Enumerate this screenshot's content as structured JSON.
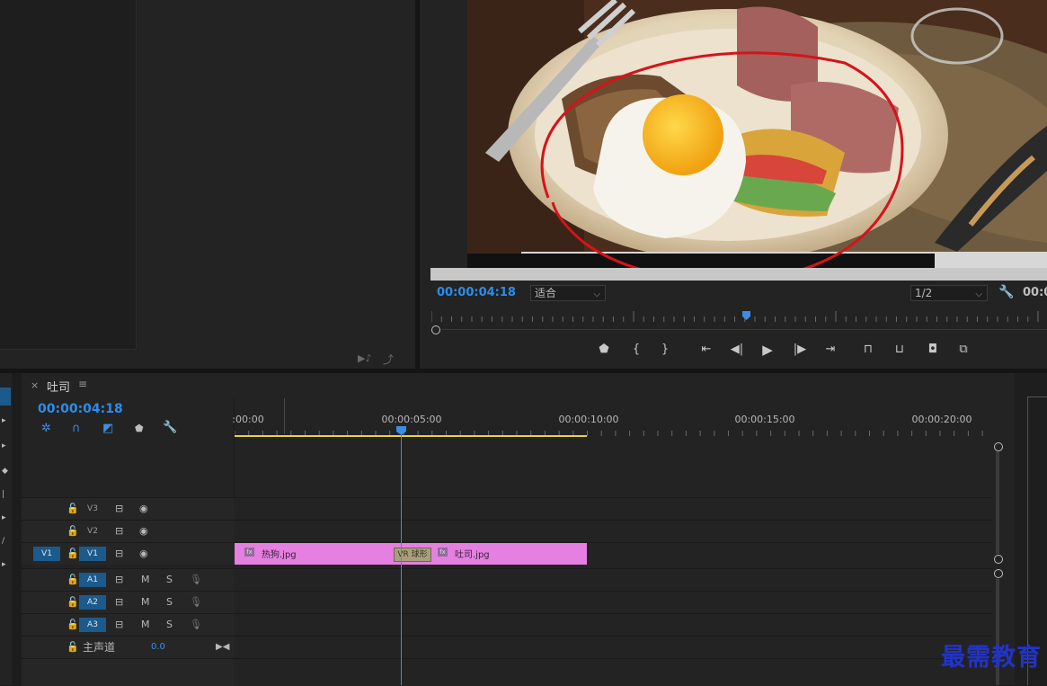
{
  "program_monitor": {
    "timecode": "00:00:04:18",
    "zoom_select": "适合",
    "resolution_select": "1/2",
    "timecode_right": "00:0"
  },
  "timeline": {
    "close": "×",
    "sequence_name": "吐司",
    "menu": "≡",
    "timecode": "00:00:04:18",
    "ruler_labels": [
      ":00:00",
      "00:00:05:00",
      "00:00:10:00",
      "00:00:15:00",
      "00:00:20:00"
    ],
    "tracks": {
      "v3": "V3",
      "v2": "V2",
      "v1": "V1",
      "v1_source": "V1",
      "a1": "A1",
      "a2": "A2",
      "a3": "A3",
      "mute": "M",
      "solo": "S",
      "master": "主声道",
      "master_value": "0.0"
    },
    "clips": [
      {
        "name": "热狗.jpg",
        "fx": "fx"
      },
      {
        "name": "吐司.jpg",
        "fx": "fx"
      }
    ],
    "transition": "VR 球形"
  },
  "watermark": "最需教育",
  "colors": {
    "accent": "#2d8ceb",
    "clip": "#e57fe1",
    "track_active": "#1c5a8c",
    "work_area": "#e6d24a"
  }
}
